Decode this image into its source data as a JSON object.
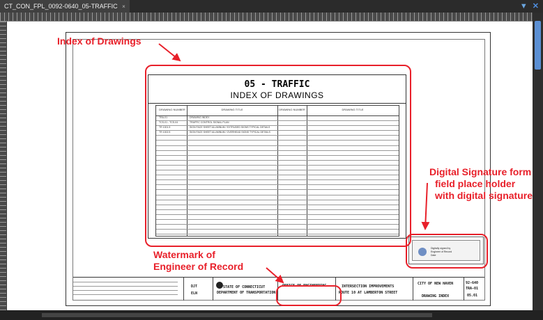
{
  "window": {
    "tab_title": "CT_CON_FPL_0092-0640_05-TRAFFIC",
    "tab_close": "×"
  },
  "drawing": {
    "title": "05 - TRAFFIC",
    "subtitle": "INDEX OF DRAWINGS",
    "table_headers": [
      "DRAWING NUMBER",
      "DRAWING TITLE",
      "DRAWING NUMBER",
      "DRAWING TITLE"
    ],
    "rows": [
      {
        "number": "TRA-01",
        "title": "DRAWING INDEX"
      },
      {
        "number": "TCS-01 - TCS-04",
        "title": "TRAFFIC CONTROL SIGNAL PLAN"
      },
      {
        "number": "TR 1001.5",
        "title": "SIGN FACE SHEET ALUMINUM / EXTRUDED SIGNS TYPICAL DETAILS"
      },
      {
        "number": "TR 1002.5",
        "title": "SIGN FACE SHEET ALUMINUM / OVERHEAD SIGNS TYPICAL DETAILS"
      }
    ],
    "title_block": {
      "state": "STATE OF CONNECTICUT",
      "department": "DEPARTMENT OF TRANSPORTATION",
      "office": "OFFICE OF ENGINEERING",
      "project_line1": "INTERSECTION IMPROVEMENTS",
      "project_line2": "ROUTE 10 AT LAMBERTON STREET",
      "town": "CITY OF NEW HAVEN",
      "sheet_title": "DRAWING INDEX",
      "project_no": "92-640",
      "drawing_no": "TRA-01",
      "sheet_no": "05.01",
      "designer": "DJT",
      "checker": "ELN"
    }
  },
  "annotations": {
    "index_label": "Index of Drawings",
    "signature_label_1": "Digital Signature form",
    "signature_label_2": "field place holder",
    "signature_label_3": "with digital signature",
    "watermark_label_1": "Watermark of",
    "watermark_label_2": "Engineer of Record",
    "color": "#e8202a"
  },
  "signature_box": {
    "line1": "Digitally signed by",
    "line2": "Engineer of Record",
    "line3": "Date"
  },
  "icons": [
    "dropdown-icon",
    "close-icon"
  ]
}
